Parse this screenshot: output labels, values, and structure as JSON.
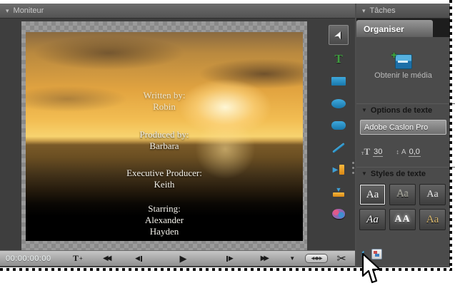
{
  "glyphs": {
    "panel_triangle": "▾",
    "section_triangle": "▼",
    "select_arrow": "➤",
    "text_tool": "T",
    "rewind": "◀◀",
    "step_back_tri": "◀",
    "play": "▶",
    "step_fwd_tri": "▶",
    "fast_forward": "▶▶",
    "shuttle": "▼",
    "jog": "◀◀ ▶▶",
    "scissors": "✂",
    "media_plus": "+",
    "size_t_small": "т",
    "size_t_big": "T",
    "kern_arrow": "↕",
    "kern_letter": "A",
    "mini_text": "t"
  },
  "colors": {
    "shape_tool_blue": "#2f9ed2",
    "text_tool_green": "#3f9d3f",
    "align_orange": "#eda424",
    "panel_bg": "#4b4b4b",
    "toolbar_bg": "#b0b0b0"
  },
  "monitor": {
    "title": "Moniteur",
    "timecode": "00:00:00:00",
    "credits": [
      {
        "role": "Written by:",
        "names": "Robin"
      },
      {
        "role": "Produced by:",
        "names": "Barbara"
      },
      {
        "role": "Executive Producer:",
        "names": "Keith"
      },
      {
        "role": "Starring:",
        "names": "Alexander\nHayden"
      }
    ]
  },
  "tasks": {
    "title": "Tâches",
    "tab": "Organiser",
    "get_media_label": "Obtenir le média",
    "text_options": {
      "header": "Options de texte",
      "font_name": "Adobe Caslon Pro",
      "font_size": "30",
      "kerning": "0,0"
    },
    "text_styles": {
      "header": "Styles de texte",
      "swatches": [
        "Aa",
        "Aa",
        "Aa",
        "Aa",
        "AA",
        "Aa"
      ]
    }
  }
}
